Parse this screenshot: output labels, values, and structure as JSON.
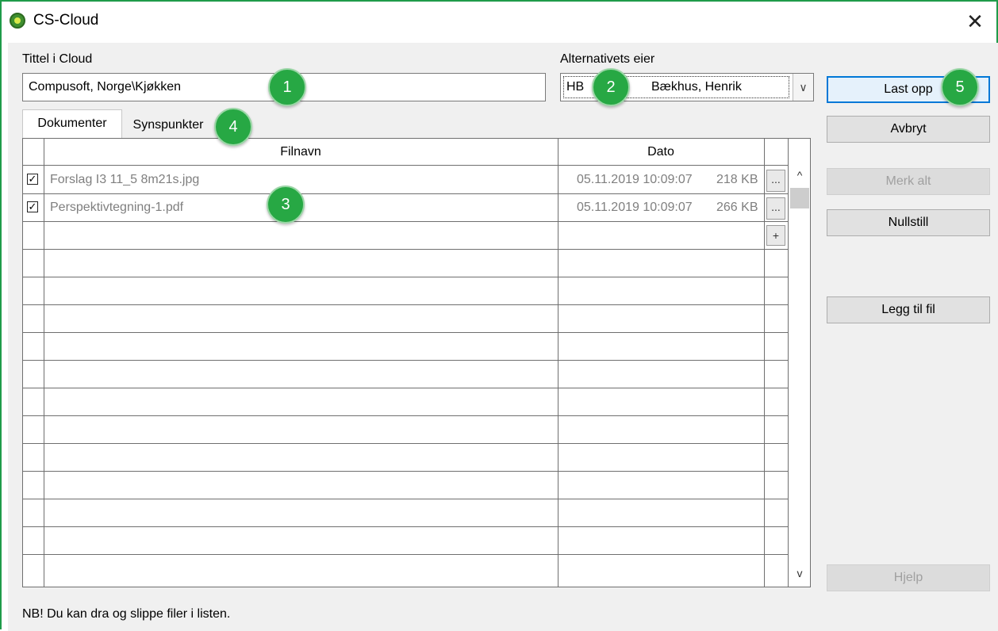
{
  "window": {
    "title": "CS-Cloud",
    "close_icon": "close-icon",
    "app_icon": "cs-cloud-logo-icon"
  },
  "form": {
    "title_label": "Tittel i Cloud",
    "title_value": "Compusoft, Norge\\Kjøkken",
    "owner_label": "Alternativets eier",
    "owner_code": "HB",
    "owner_name": "Bækhus, Henrik"
  },
  "tabs": [
    {
      "label": "Dokumenter",
      "active": true
    },
    {
      "label": "Synspunkter",
      "active": false
    }
  ],
  "table": {
    "columns": [
      "Filnavn",
      "Dato"
    ],
    "rows": [
      {
        "checked": true,
        "filename": "Forslag I3 11_5 8m21s.jpg",
        "date": "05.11.2019 10:09:07",
        "size": "218 KB",
        "action": "..."
      },
      {
        "checked": true,
        "filename": "Perspektivtegning-1.pdf",
        "date": "05.11.2019 10:09:07",
        "size": "266 KB",
        "action": "..."
      }
    ],
    "add_label": "+",
    "scroll_up": "^",
    "scroll_down": "v"
  },
  "buttons": {
    "upload": "Last opp",
    "cancel": "Avbryt",
    "select_all": "Merk alt",
    "reset": "Nullstill",
    "add_file": "Legg til fil",
    "help": "Hjelp"
  },
  "badges": [
    "1",
    "2",
    "3",
    "4",
    "5"
  ],
  "note": "NB! Du kan dra og slippe filer i listen.",
  "colors": {
    "accent": "#0078d7",
    "badge": "#27a844",
    "frame": "#1f9b4a"
  }
}
